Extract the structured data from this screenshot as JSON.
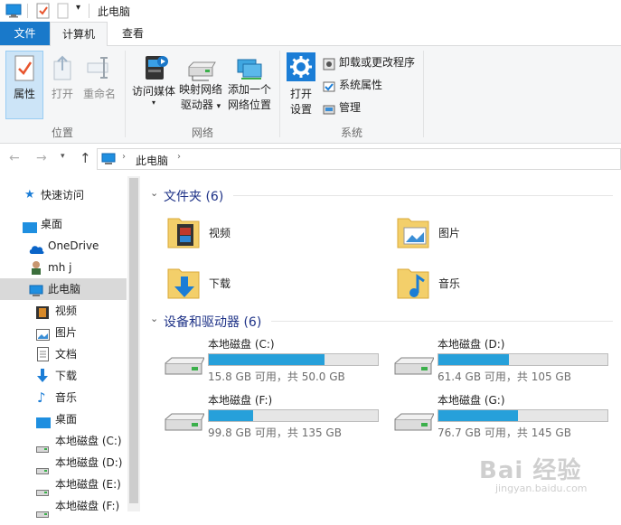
{
  "window": {
    "title": "此电脑"
  },
  "tabs": {
    "file": "文件",
    "computer": "计算机",
    "view": "查看"
  },
  "ribbon": {
    "location_group": {
      "label": "位置",
      "properties": "属性",
      "open": "打开",
      "rename": "重命名"
    },
    "network_group": {
      "label": "网络",
      "media": "访问媒体",
      "map_line1": "映射网络",
      "map_line2": "驱动器",
      "add_line1": "添加一个",
      "add_line2": "网络位置"
    },
    "system_group": {
      "label": "系统",
      "open_line1": "打开",
      "open_line2": "设置",
      "uninstall": "卸载或更改程序",
      "sysprops": "系统属性",
      "manage": "管理"
    }
  },
  "address": {
    "crumb": "此电脑"
  },
  "nav": {
    "items": [
      {
        "label": "快速访问"
      },
      {
        "label": "桌面"
      },
      {
        "label": "OneDrive"
      },
      {
        "label": "mh j"
      },
      {
        "label": "此电脑"
      },
      {
        "label": "视频"
      },
      {
        "label": "图片"
      },
      {
        "label": "文档"
      },
      {
        "label": "下载"
      },
      {
        "label": "音乐"
      },
      {
        "label": "桌面"
      },
      {
        "label": "本地磁盘 (C:)"
      },
      {
        "label": "本地磁盘 (D:)"
      },
      {
        "label": "本地磁盘 (E:)"
      },
      {
        "label": "本地磁盘 (F:)"
      }
    ]
  },
  "folders": {
    "title": "文件夹 (6)",
    "items": [
      {
        "label": "视频"
      },
      {
        "label": "图片"
      },
      {
        "label": "下载"
      },
      {
        "label": "音乐"
      }
    ]
  },
  "drives": {
    "title": "设备和驱动器 (6)",
    "items": [
      {
        "label": "本地磁盘 (C:)",
        "info": "15.8 GB 可用，共 50.0 GB",
        "used_fraction": 0.684
      },
      {
        "label": "本地磁盘 (D:)",
        "info": "61.4 GB 可用，共 105 GB",
        "used_fraction": 0.415
      },
      {
        "label": "本地磁盘 (F:)",
        "info": "99.8 GB 可用，共 135 GB",
        "used_fraction": 0.261
      },
      {
        "label": "本地磁盘 (G:)",
        "info": "76.7 GB 可用，共 145 GB",
        "used_fraction": 0.471
      }
    ]
  },
  "watermark": {
    "brand": "Bai 经验",
    "url": "jingyan.baidu.com"
  }
}
